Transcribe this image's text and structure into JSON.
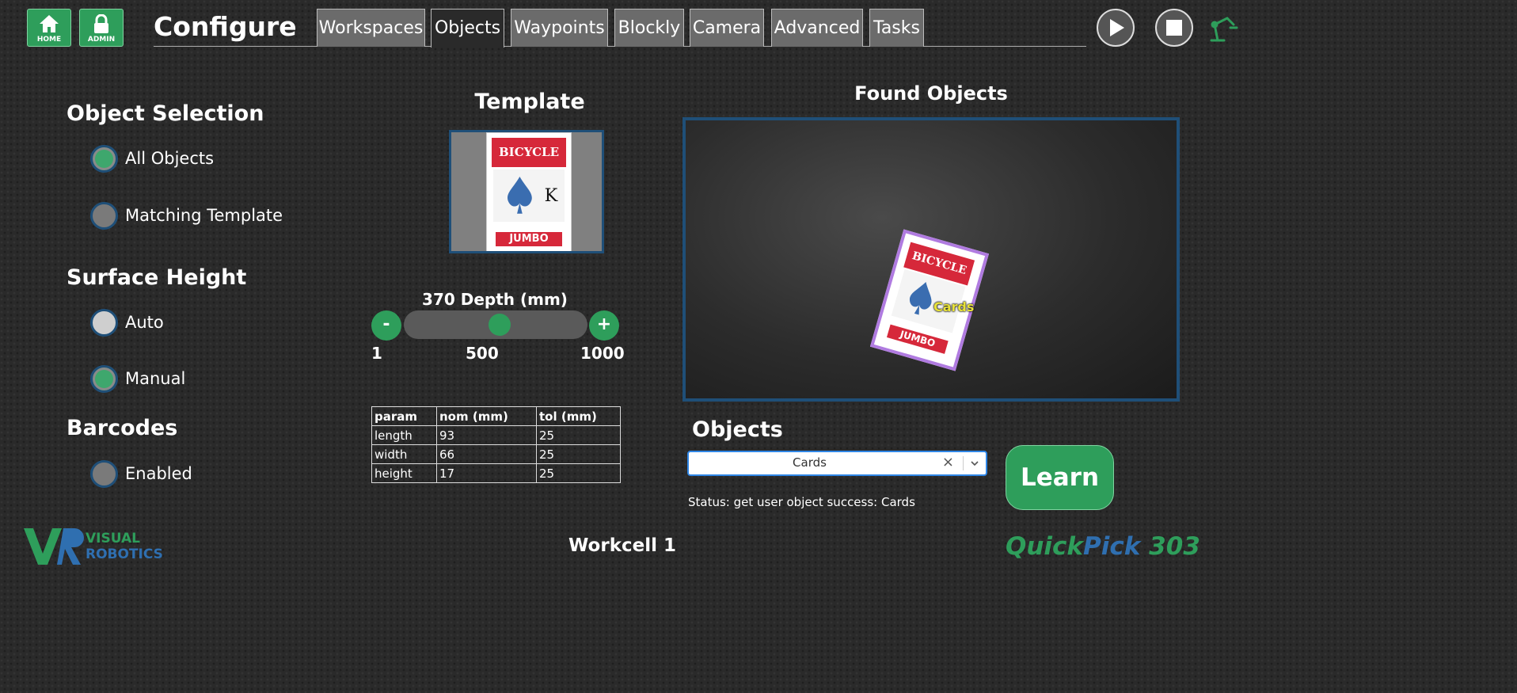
{
  "header": {
    "home_label": "HOME",
    "admin_label": "ADMIN",
    "title": "Configure",
    "tabs": [
      "Workspaces",
      "Objects",
      "Waypoints",
      "Blockly",
      "Camera",
      "Advanced",
      "Tasks"
    ],
    "active_tab": "Objects"
  },
  "object_selection": {
    "title": "Object Selection",
    "options": [
      {
        "label": "All Objects",
        "selected": true
      },
      {
        "label": "Matching Template",
        "selected": false
      }
    ]
  },
  "surface_height": {
    "title": "Surface Height",
    "options": [
      {
        "label": "Auto",
        "selected": false
      },
      {
        "label": "Manual",
        "selected": true
      }
    ]
  },
  "barcodes": {
    "title": "Barcodes",
    "options": [
      {
        "label": "Enabled",
        "selected": false
      }
    ]
  },
  "template": {
    "title": "Template",
    "card_brand": "BICYCLE",
    "card_corner": "K",
    "card_bottom": "JUMBO"
  },
  "depth": {
    "label": "370 Depth (mm)",
    "value": 370,
    "min": 1,
    "max": 1000,
    "min_label": "1",
    "mid_label": "500",
    "max_label": "1000",
    "minus_label": "-",
    "plus_label": "+"
  },
  "params_table": {
    "headers": [
      "param",
      "nom (mm)",
      "tol (mm)"
    ],
    "rows": [
      [
        "length",
        "93",
        "25"
      ],
      [
        "width",
        "66",
        "25"
      ],
      [
        "height",
        "17",
        "25"
      ]
    ]
  },
  "found_objects": {
    "title": "Found Objects",
    "detection_label": "Cards"
  },
  "objects_panel": {
    "title": "Objects",
    "selected": "Cards",
    "clear_glyph": "×",
    "learn_label": "Learn",
    "status": "Status: get user object success: Cards"
  },
  "footer": {
    "logo_text_1": "VISUAL",
    "logo_text_2": "ROBOTICS",
    "workcell": "Workcell 1",
    "product_quick": "Quick",
    "product_pick": "Pick",
    "product_model": " 303"
  },
  "colors": {
    "accent_green": "#2e9e5b",
    "border_blue": "#1f4f78",
    "product_blue": "#2f6fb0"
  }
}
